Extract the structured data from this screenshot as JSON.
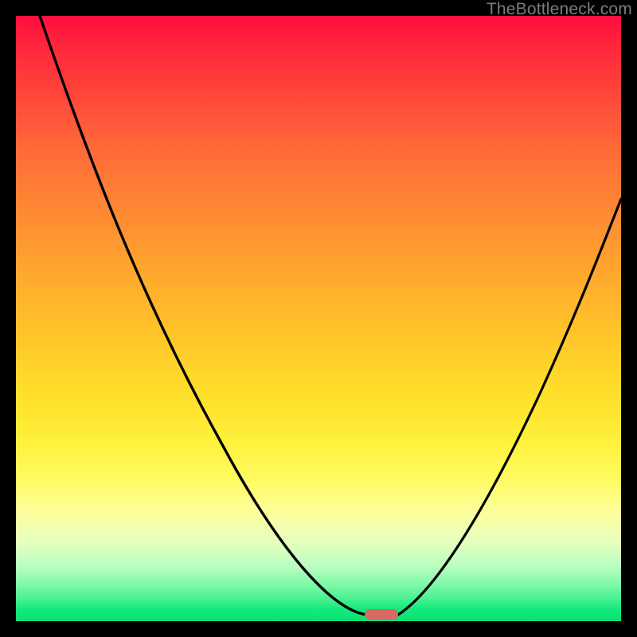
{
  "watermark": "TheBottleneck.com",
  "chart_data": {
    "type": "line",
    "title": "",
    "xlabel": "",
    "ylabel": "",
    "xlim": [
      0,
      100
    ],
    "ylim": [
      0,
      100
    ],
    "legend": false,
    "grid": false,
    "background_gradient": {
      "top": "#ff0e3f",
      "middle": "#ffde2a",
      "bottom": "#06e273"
    },
    "series": [
      {
        "name": "bottleneck-curve",
        "x": [
          4,
          10,
          18,
          26,
          34,
          42,
          50,
          55,
          58,
          60,
          62,
          66,
          72,
          80,
          88,
          96,
          100
        ],
        "y": [
          100,
          86,
          70,
          56,
          42,
          30,
          18,
          9,
          4,
          1,
          3,
          10,
          22,
          38,
          54,
          70,
          78
        ]
      }
    ],
    "marker": {
      "name": "optimal-zone",
      "x_center": 60,
      "y": 0,
      "color": "#d86a64"
    }
  }
}
